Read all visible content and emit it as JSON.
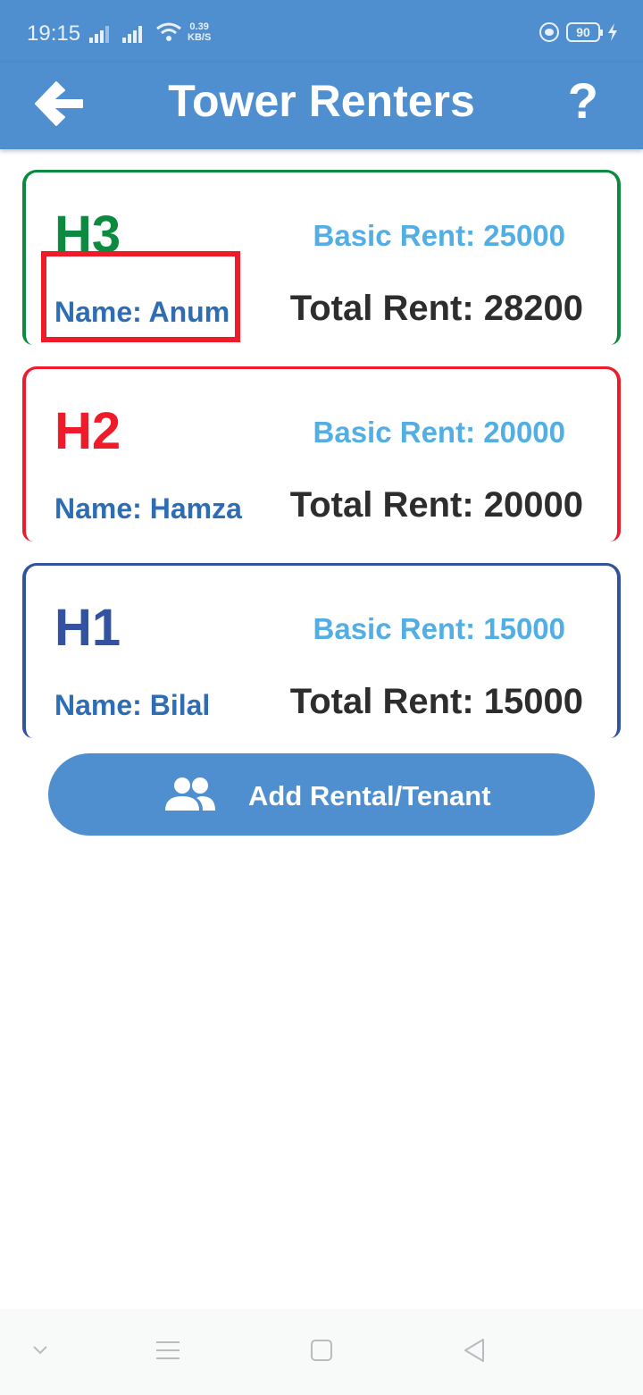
{
  "status": {
    "time": "19:15",
    "net_speed_value": "0.39",
    "net_speed_unit": "KB/S",
    "battery": "90",
    "icons": [
      "signal-icon",
      "signal-icon",
      "wifi-icon",
      "eye-comfort-icon",
      "battery-icon",
      "charging-icon"
    ]
  },
  "header": {
    "title": "Tower Renters",
    "back_icon": "back-arrow-icon",
    "help_label": "?"
  },
  "rentals": [
    {
      "unit": "H3",
      "basic_rent": "Basic Rent: 25000",
      "name": "Name: Anum",
      "total_rent": "Total Rent: 28200",
      "color": "#0c8a40"
    },
    {
      "unit": "H2",
      "basic_rent": "Basic Rent: 20000",
      "name": "Name: Hamza",
      "total_rent": "Total Rent: 20000",
      "color": "#ee1b2a"
    },
    {
      "unit": "H1",
      "basic_rent": "Basic Rent: 15000",
      "name": "Name: Bilal",
      "total_rent": "Total Rent: 15000",
      "color": "#3353a0"
    }
  ],
  "add_button": {
    "label": "Add Rental/Tenant",
    "icon": "people-icon"
  },
  "highlight_color": "#ee1b2a",
  "accent_color": "#4f8fcf",
  "navbar": {
    "icons": [
      "chevron-down-icon",
      "menu-icon",
      "home-square-icon",
      "back-triangle-icon"
    ]
  }
}
